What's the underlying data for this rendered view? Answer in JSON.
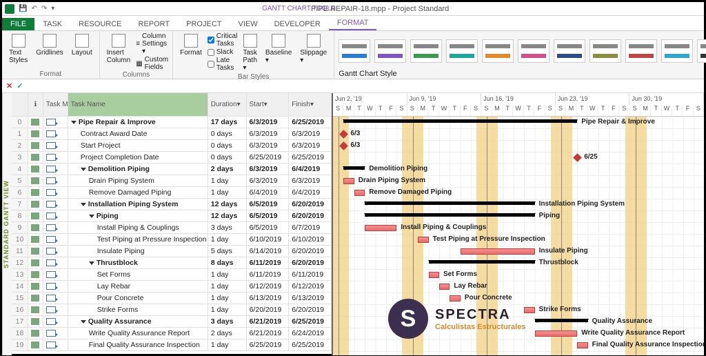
{
  "app": {
    "title": "PIPE REPAIR-18.mpp - Project Standard",
    "contextual": "GANTT CHART TOOLS"
  },
  "tabs": {
    "file": "FILE",
    "task": "TASK",
    "resource": "RESOURCE",
    "report": "REPORT",
    "project": "PROJECT",
    "view": "VIEW",
    "developer": "DEVELOPER",
    "format": "FORMAT"
  },
  "ribbon": {
    "format_group": "Format",
    "columns_group": "Columns",
    "bar_group": "Bar Styles",
    "gantt_group": "Gantt Chart Style",
    "text_styles": "Text Styles",
    "gridlines": "Gridlines",
    "layout": "Layout",
    "insert_col": "Insert Column",
    "col_settings": "Column Settings ▾",
    "custom_fields": "Custom Fields",
    "format_btn": "Format",
    "critical": "Critical Tasks",
    "slack": "Slack",
    "late": "Late Tasks",
    "task_path": "Task Path ▾",
    "baseline": "Baseline ▾",
    "slippage": "Slippage ▾"
  },
  "sidebar": "STANDARD GANTT VIEW",
  "columns": {
    "info": "ℹ",
    "mode": "Task Mode",
    "name": "Task Name",
    "dur": "Duration",
    "start": "Start",
    "fin": "Finish"
  },
  "timeline": {
    "day_w": 15.4,
    "weeks": [
      "Jun 2, '19",
      "Jun 9, '19",
      "Jun 16, '19",
      "Jun 23, '19",
      "Jun 30, '19"
    ],
    "days": "SMTWTFS"
  },
  "tasks": [
    {
      "id": 0,
      "name": "Pipe Repair & Improve",
      "dur": "17 days",
      "start": "6/3/2019",
      "fin": "6/25/2019",
      "lvl": 0,
      "sum": true,
      "barStart": 1,
      "barLen": 22,
      "label": "Pipe Repair & Improve"
    },
    {
      "id": 1,
      "name": "Contract Award Date",
      "dur": "0 days",
      "start": "6/3/2019",
      "fin": "6/3/2019",
      "lvl": 1,
      "ms": true,
      "barStart": 1,
      "label": "6/3"
    },
    {
      "id": 2,
      "name": "Start Project",
      "dur": "0 days",
      "start": "6/3/2019",
      "fin": "6/3/2019",
      "lvl": 1,
      "ms": true,
      "barStart": 1,
      "label": "6/3"
    },
    {
      "id": 3,
      "name": "Project Completion Date",
      "dur": "0 days",
      "start": "6/25/2019",
      "fin": "6/25/2019",
      "lvl": 1,
      "ms": true,
      "barStart": 23,
      "label": "6/25"
    },
    {
      "id": 4,
      "name": "Demolition Piping",
      "dur": "2 days",
      "start": "6/3/2019",
      "fin": "6/4/2019",
      "lvl": 1,
      "sum": true,
      "barStart": 1,
      "barLen": 2,
      "label": "Demolition Piping"
    },
    {
      "id": 5,
      "name": "Drain Piping System",
      "dur": "1 day",
      "start": "6/3/2019",
      "fin": "6/3/2019",
      "lvl": 2,
      "barStart": 1,
      "barLen": 1,
      "label": "Drain Piping System"
    },
    {
      "id": 6,
      "name": "Remove Damaged Piping",
      "dur": "1 day",
      "start": "6/4/2019",
      "fin": "6/4/2019",
      "lvl": 2,
      "barStart": 2,
      "barLen": 1,
      "label": "Remove Damaged Piping"
    },
    {
      "id": 7,
      "name": "Installation Piping System",
      "dur": "12 days",
      "start": "6/5/2019",
      "fin": "6/20/2019",
      "lvl": 1,
      "sum": true,
      "barStart": 3,
      "barLen": 16,
      "label": "Installation Piping System"
    },
    {
      "id": 8,
      "name": "Piping",
      "dur": "12 days",
      "start": "6/5/2019",
      "fin": "6/20/2019",
      "lvl": 2,
      "sum": true,
      "barStart": 3,
      "barLen": 16,
      "label": "Piping"
    },
    {
      "id": 9,
      "name": "Install Piping & Couplings",
      "dur": "3 days",
      "start": "6/5/2019",
      "fin": "6/7/2019",
      "lvl": 3,
      "barStart": 3,
      "barLen": 3,
      "label": "Install Piping & Couplings"
    },
    {
      "id": 10,
      "name": "Test Piping at Pressure Inspection",
      "dur": "1 day",
      "start": "6/10/2019",
      "fin": "6/10/2019",
      "lvl": 3,
      "barStart": 8,
      "barLen": 1,
      "label": "Test Piping at Pressure Inspection"
    },
    {
      "id": 11,
      "name": "Insulate Piping",
      "dur": "5 days",
      "start": "6/14/2019",
      "fin": "6/20/2019",
      "lvl": 3,
      "barStart": 12,
      "barLen": 7,
      "label": "Insulate Piping"
    },
    {
      "id": 12,
      "name": "Thrustblock",
      "dur": "8 days",
      "start": "6/11/2019",
      "fin": "6/20/2019",
      "lvl": 2,
      "sum": true,
      "barStart": 9,
      "barLen": 10,
      "label": "Thrustblock"
    },
    {
      "id": 13,
      "name": "Set Forms",
      "dur": "1 day",
      "start": "6/11/2019",
      "fin": "6/11/2019",
      "lvl": 3,
      "barStart": 9,
      "barLen": 1,
      "label": "Set Forms"
    },
    {
      "id": 14,
      "name": "Lay Rebar",
      "dur": "1 day",
      "start": "6/12/2019",
      "fin": "6/12/2019",
      "lvl": 3,
      "barStart": 10,
      "barLen": 1,
      "label": "Lay Rebar"
    },
    {
      "id": 15,
      "name": "Pour Concrete",
      "dur": "1 day",
      "start": "6/13/2019",
      "fin": "6/13/2019",
      "lvl": 3,
      "barStart": 11,
      "barLen": 1,
      "label": "Pour Concrete"
    },
    {
      "id": 16,
      "name": "Strike Forms",
      "dur": "1 day",
      "start": "6/20/2019",
      "fin": "6/20/2019",
      "lvl": 3,
      "barStart": 18,
      "barLen": 1,
      "label": "Strike Forms"
    },
    {
      "id": 17,
      "name": "Quality Assurance",
      "dur": "3 days",
      "start": "6/21/2019",
      "fin": "6/25/2019",
      "lvl": 1,
      "sum": true,
      "barStart": 19,
      "barLen": 5,
      "label": "Quality Assurance"
    },
    {
      "id": 18,
      "name": "Write Quality Assurance Report",
      "dur": "2 days",
      "start": "6/21/2019",
      "fin": "6/24/2019",
      "lvl": 2,
      "barStart": 19,
      "barLen": 4,
      "label": "Write Quality Assurance Report"
    },
    {
      "id": 19,
      "name": "Final Quality Assurance Inspection",
      "dur": "1 day",
      "start": "6/25/2019",
      "fin": "6/25/2019",
      "lvl": 2,
      "barStart": 23,
      "barLen": 1,
      "label": "Final Quality Assurance Inspection"
    }
  ],
  "watermark": {
    "logo": "S",
    "name": "SPECTRA",
    "sub": "Calculistas Estructurales"
  }
}
